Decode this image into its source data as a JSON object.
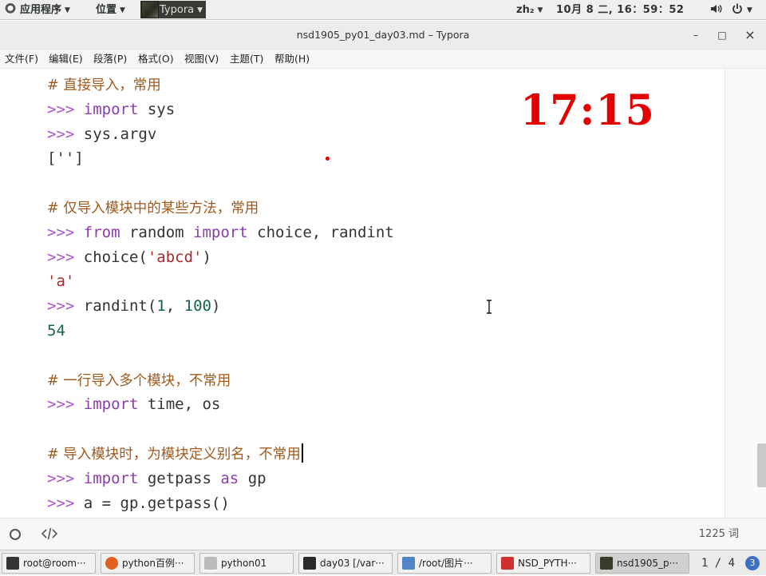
{
  "top_panel": {
    "apps_menu": "应用程序",
    "places_menu": "位置",
    "running_app": "Typora",
    "input_method": "zh₂",
    "clock": "10月  8 二, 16：59：52",
    "volume_icon": "speaker-icon",
    "power_icon": "power-icon"
  },
  "window": {
    "title": "nsd1905_py01_day03.md – Typora",
    "minimize": "–",
    "maximize": "□",
    "close": "×"
  },
  "menubar": [
    "文件(F)",
    "编辑(E)",
    "段落(P)",
    "格式(O)",
    "视图(V)",
    "主题(T)",
    "帮助(H)"
  ],
  "editor": {
    "lines": [
      [
        {
          "t": "# 直接导入，常用",
          "c": "comment"
        }
      ],
      [
        {
          "t": ">>> ",
          "c": "prompt"
        },
        {
          "t": "import",
          "c": "kw"
        },
        {
          "t": " sys",
          "c": "plain"
        }
      ],
      [
        {
          "t": ">>> ",
          "c": "prompt"
        },
        {
          "t": "sys.argv",
          "c": "plain"
        }
      ],
      [
        {
          "t": "['']",
          "c": "plain"
        }
      ],
      [],
      [
        {
          "t": "# 仅导入模块中的某些方法，常用",
          "c": "comment"
        }
      ],
      [
        {
          "t": ">>> ",
          "c": "prompt"
        },
        {
          "t": "from",
          "c": "kw"
        },
        {
          "t": " random ",
          "c": "plain"
        },
        {
          "t": "import",
          "c": "kw"
        },
        {
          "t": " choice, randint",
          "c": "plain"
        }
      ],
      [
        {
          "t": ">>> ",
          "c": "prompt"
        },
        {
          "t": "choice(",
          "c": "plain"
        },
        {
          "t": "'abcd'",
          "c": "str"
        },
        {
          "t": ")",
          "c": "plain"
        }
      ],
      [
        {
          "t": "'a'",
          "c": "str"
        }
      ],
      [
        {
          "t": ">>> ",
          "c": "prompt"
        },
        {
          "t": "randint(",
          "c": "plain"
        },
        {
          "t": "1",
          "c": "num"
        },
        {
          "t": ", ",
          "c": "plain"
        },
        {
          "t": "100",
          "c": "num"
        },
        {
          "t": ")",
          "c": "plain"
        }
      ],
      [
        {
          "t": "54",
          "c": "num"
        }
      ],
      [],
      [
        {
          "t": "# 一行导入多个模块，不常用",
          "c": "comment"
        }
      ],
      [
        {
          "t": ">>> ",
          "c": "prompt"
        },
        {
          "t": "import",
          "c": "kw"
        },
        {
          "t": " time, os",
          "c": "plain"
        }
      ],
      [],
      [
        {
          "t": "# 导入模块时，为模块定义别名，不常用",
          "c": "comment",
          "caret": true
        }
      ],
      [
        {
          "t": ">>> ",
          "c": "prompt"
        },
        {
          "t": "import",
          "c": "kw"
        },
        {
          "t": " getpass ",
          "c": "plain"
        },
        {
          "t": "as",
          "c": "kw"
        },
        {
          "t": " gp",
          "c": "plain"
        }
      ],
      [
        {
          "t": ">>> ",
          "c": "prompt"
        },
        {
          "t": "a = gp.getpass()",
          "c": "plain"
        }
      ]
    ],
    "timer_overlay": "17:15"
  },
  "statusbar": {
    "word_count": "1225 词"
  },
  "taskbar": {
    "tasks": [
      {
        "label": "root@room···",
        "icon": "terminal-icon",
        "color": "#333333"
      },
      {
        "label": "python百例···",
        "icon": "firefox-icon",
        "color": "#e06020"
      },
      {
        "label": "python01",
        "icon": "file-manager-icon",
        "color": "#bbbbbb"
      },
      {
        "label": "day03 [/var···",
        "icon": "pycharm-icon",
        "color": "#2a2a2a"
      },
      {
        "label": "/root/图片···",
        "icon": "image-viewer-icon",
        "color": "#4f86c6"
      },
      {
        "label": "NSD_PYTH···",
        "icon": "document-icon",
        "color": "#d03030"
      },
      {
        "label": "nsd1905_p···",
        "icon": "typora-icon",
        "color": "#3a3a2a"
      }
    ],
    "pager": "1 / 4",
    "badge": "3"
  }
}
